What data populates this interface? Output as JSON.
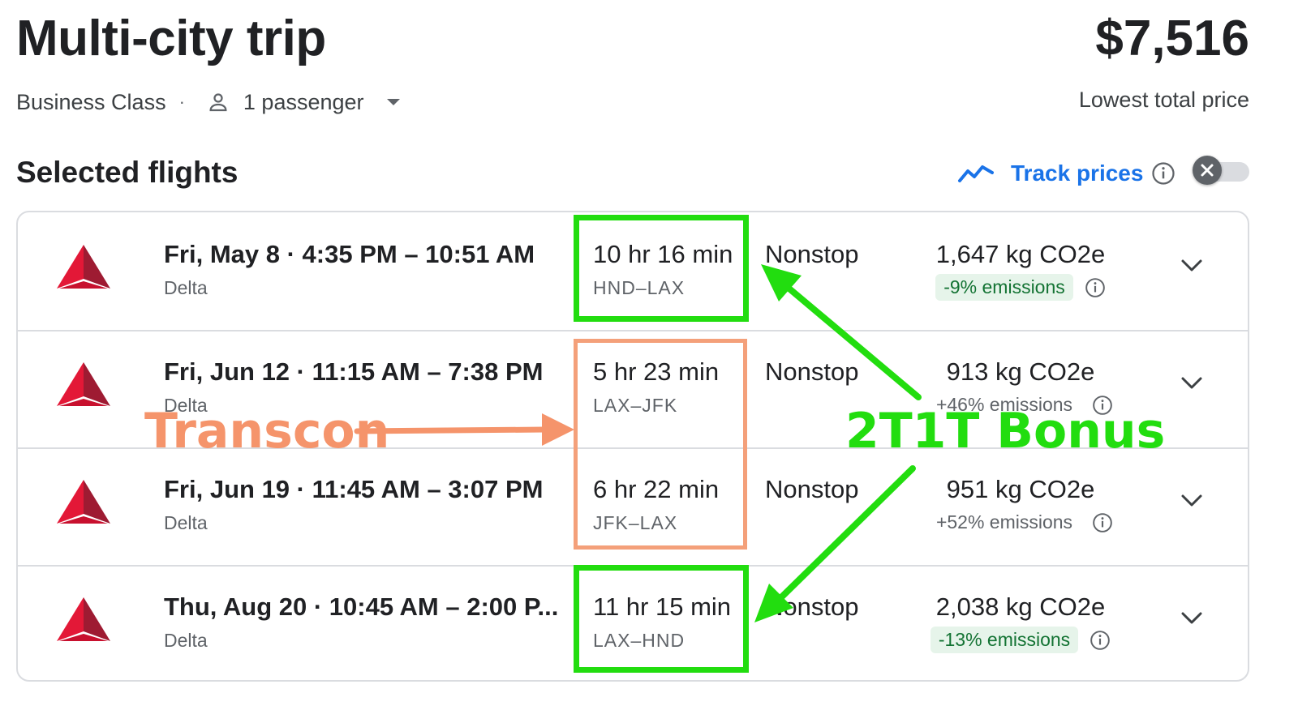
{
  "header": {
    "title": "Multi-city trip",
    "price": "$7,516",
    "price_label": "Lowest total price",
    "cabin": "Business Class",
    "separator": "·",
    "passengers": "1 passenger"
  },
  "section": {
    "title": "Selected flights",
    "track_prices_label": "Track prices",
    "track_toggle_state": "off"
  },
  "flights": [
    {
      "times": "Fri, May 8  ·  4:35 PM – 10:51 AM",
      "airline": "Delta",
      "duration": "10 hr 16 min",
      "route": "HND–LAX",
      "stops": "Nonstop",
      "co2": "1,647 kg CO2e",
      "emissions": "-9% emissions",
      "emissions_good": true
    },
    {
      "times": "Fri, Jun 12  ·  11:15 AM – 7:38 PM",
      "airline": "Delta",
      "duration": "5 hr 23 min",
      "route": "LAX–JFK",
      "stops": "Nonstop",
      "co2": "913 kg CO2e",
      "emissions": "+46% emissions",
      "emissions_good": false
    },
    {
      "times": "Fri, Jun 19  ·  11:45 AM – 3:07 PM",
      "airline": "Delta",
      "duration": "6 hr 22 min",
      "route": "JFK–LAX",
      "stops": "Nonstop",
      "co2": "951 kg CO2e",
      "emissions": "+52% emissions",
      "emissions_good": false
    },
    {
      "times": "Thu, Aug 20  ·  10:45 AM – 2:00 P...",
      "airline": "Delta",
      "duration": "11 hr 15 min",
      "route": "LAX–HND",
      "stops": "Nonstop",
      "co2": "2,038 kg CO2e",
      "emissions": "-13% emissions",
      "emissions_good": true
    }
  ],
  "annotations": {
    "transcon": "Transcon",
    "bonus": "2T1T Bonus"
  },
  "colors": {
    "delta_red": "#c8102e",
    "accent_blue": "#1a73e8",
    "annotation_green": "#22dd0f",
    "annotation_orange": "#f5946b"
  }
}
